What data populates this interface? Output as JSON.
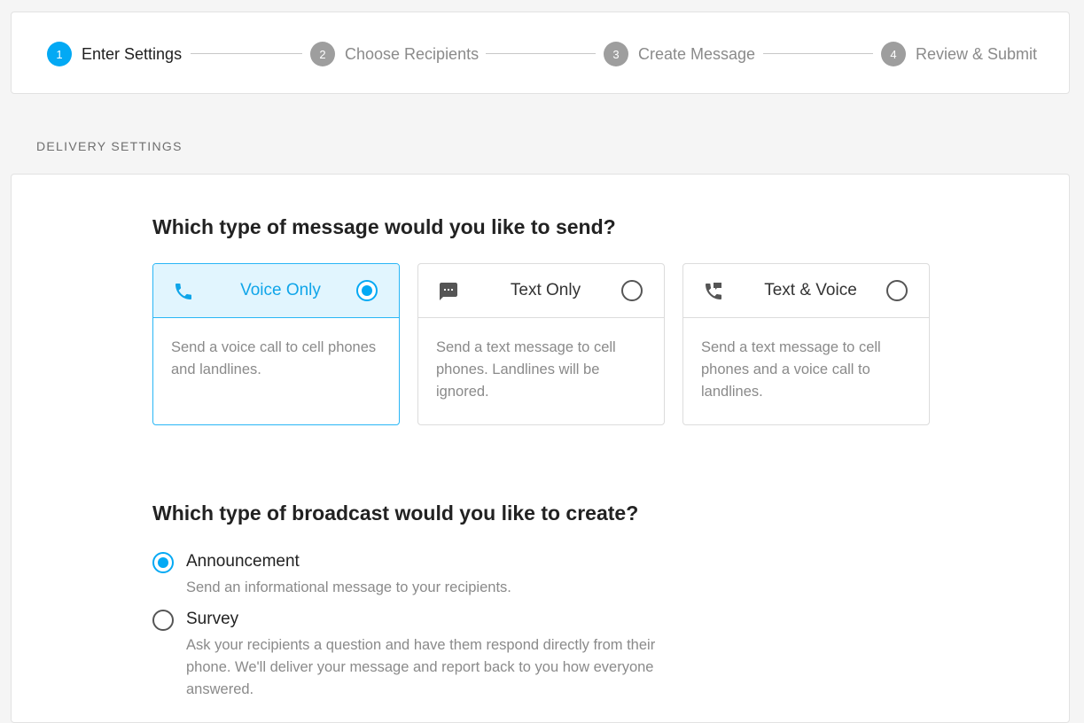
{
  "stepper": {
    "steps": [
      {
        "num": "1",
        "label": "Enter Settings"
      },
      {
        "num": "2",
        "label": "Choose Recipients"
      },
      {
        "num": "3",
        "label": "Create Message"
      },
      {
        "num": "4",
        "label": "Review & Submit"
      }
    ],
    "active_step": 1
  },
  "section_title": "DELIVERY SETTINGS",
  "message_type": {
    "question": "Which type of message would you like to send?",
    "options": [
      {
        "title": "Voice Only",
        "icon": "phone-icon",
        "selected": true,
        "desc": "Send a voice call to cell phones and landlines."
      },
      {
        "title": "Text Only",
        "icon": "chat-icon",
        "selected": false,
        "desc": "Send a text message to cell phones. Landlines will be ignored."
      },
      {
        "title": "Text & Voice",
        "icon": "phone-forward-icon",
        "selected": false,
        "desc": "Send a text message to cell phones and a voice call to landlines."
      }
    ]
  },
  "broadcast_type": {
    "question": "Which type of broadcast would you like to create?",
    "options": [
      {
        "label": "Announcement",
        "selected": true,
        "desc": "Send an informational message to your recipients."
      },
      {
        "label": "Survey",
        "selected": false,
        "desc": "Ask your recipients a question and have them respond directly from their phone. We'll deliver your message and report back to you how everyone answered."
      }
    ]
  },
  "colors": {
    "accent": "#03a9f4",
    "accent_light": "#e1f5fe",
    "inactive_step": "#9e9e9e"
  }
}
